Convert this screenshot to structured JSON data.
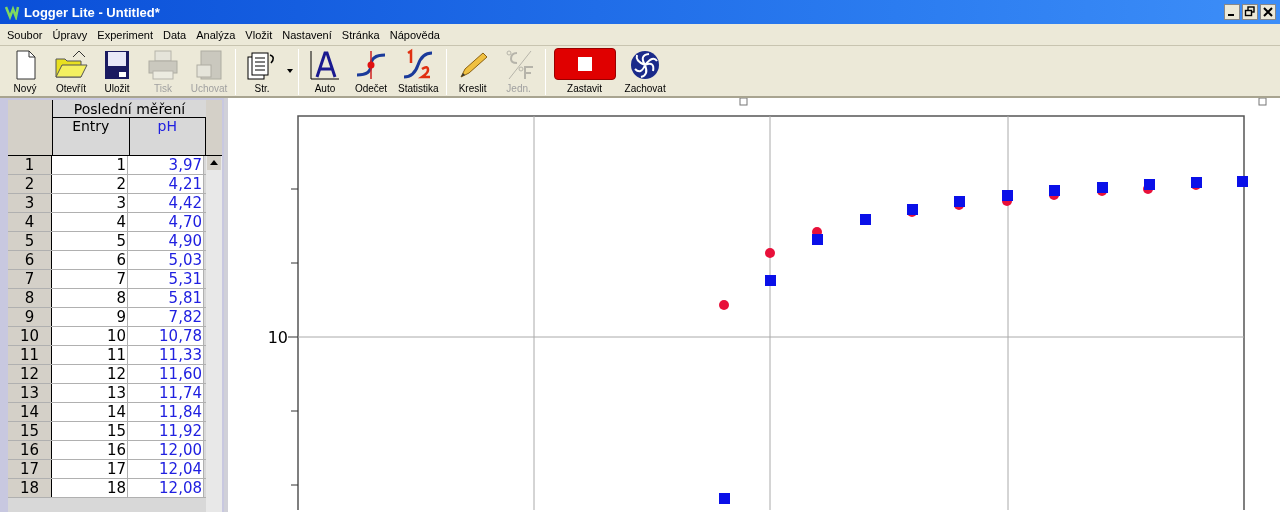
{
  "window": {
    "title": "Logger Lite - Untitled*"
  },
  "menu": [
    "Soubor",
    "Úpravy",
    "Experiment",
    "Data",
    "Analýza",
    "Vložit",
    "Nastavení",
    "Stránka",
    "Nápověda"
  ],
  "toolbar": [
    {
      "kind": "new",
      "label": "Nový",
      "disabled": false
    },
    {
      "kind": "open",
      "label": "Otevřít",
      "disabled": false
    },
    {
      "kind": "save",
      "label": "Uložit",
      "disabled": false
    },
    {
      "kind": "print",
      "label": "Tisk",
      "disabled": true
    },
    {
      "kind": "store",
      "label": "Uchovat",
      "disabled": true
    },
    {
      "kind": "page",
      "label": "Str.",
      "disabled": false
    },
    {
      "kind": "auto",
      "label": "Auto",
      "disabled": false
    },
    {
      "kind": "examine",
      "label": "Odečet",
      "disabled": false
    },
    {
      "kind": "stats",
      "label": "Statistika",
      "disabled": false
    },
    {
      "kind": "draw",
      "label": "Kreslit",
      "disabled": false
    },
    {
      "kind": "units",
      "label": "Jedn.",
      "disabled": true
    },
    {
      "kind": "stop",
      "label": "Zastavit",
      "disabled": false
    },
    {
      "kind": "collect",
      "label": "Zachovat",
      "disabled": false
    }
  ],
  "table": {
    "title": "Poslední měření",
    "columns": [
      {
        "label": "Entry",
        "color": "#000000"
      },
      {
        "label": "pH",
        "color": "#2020e0"
      }
    ],
    "rows": [
      {
        "index": "1",
        "cells": [
          "1",
          "3,97"
        ]
      },
      {
        "index": "2",
        "cells": [
          "2",
          "4,21"
        ]
      },
      {
        "index": "3",
        "cells": [
          "3",
          "4,42"
        ]
      },
      {
        "index": "4",
        "cells": [
          "4",
          "4,70"
        ]
      },
      {
        "index": "5",
        "cells": [
          "5",
          "4,90"
        ]
      },
      {
        "index": "6",
        "cells": [
          "6",
          "5,03"
        ]
      },
      {
        "index": "7",
        "cells": [
          "7",
          "5,31"
        ]
      },
      {
        "index": "8",
        "cells": [
          "8",
          "5,81"
        ]
      },
      {
        "index": "9",
        "cells": [
          "9",
          "7,82"
        ]
      },
      {
        "index": "10",
        "cells": [
          "10",
          "10,78"
        ]
      },
      {
        "index": "11",
        "cells": [
          "11",
          "11,33"
        ]
      },
      {
        "index": "12",
        "cells": [
          "12",
          "11,60"
        ]
      },
      {
        "index": "13",
        "cells": [
          "13",
          "11,74"
        ]
      },
      {
        "index": "14",
        "cells": [
          "14",
          "11,84"
        ]
      },
      {
        "index": "15",
        "cells": [
          "15",
          "11,92"
        ]
      },
      {
        "index": "16",
        "cells": [
          "16",
          "12,00"
        ]
      },
      {
        "index": "17",
        "cells": [
          "17",
          "12,04"
        ]
      },
      {
        "index": "18",
        "cells": [
          "18",
          "12,08"
        ]
      }
    ]
  },
  "graph": {
    "y_tick_label": "10"
  }
}
